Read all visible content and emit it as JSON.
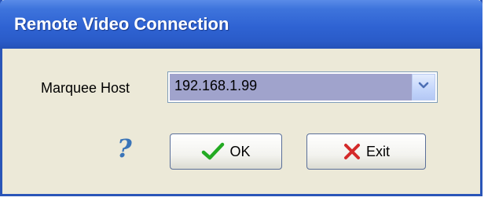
{
  "window": {
    "title": "Remote Video Connection"
  },
  "form": {
    "host_label": "Marquee Host",
    "host_value": "192.168.1.99"
  },
  "buttons": {
    "help_glyph": "?",
    "ok_label": "OK",
    "exit_label": "Exit"
  },
  "icons": {
    "dropdown": "chevron-down-icon",
    "ok": "check-icon",
    "exit": "x-icon",
    "help": "question-icon"
  },
  "colors": {
    "titlebar": "#2f63d3",
    "check": "#22aa22",
    "exit_x": "#d42a2a",
    "help": "#3a74b8",
    "selection": "#a0a3cc"
  }
}
